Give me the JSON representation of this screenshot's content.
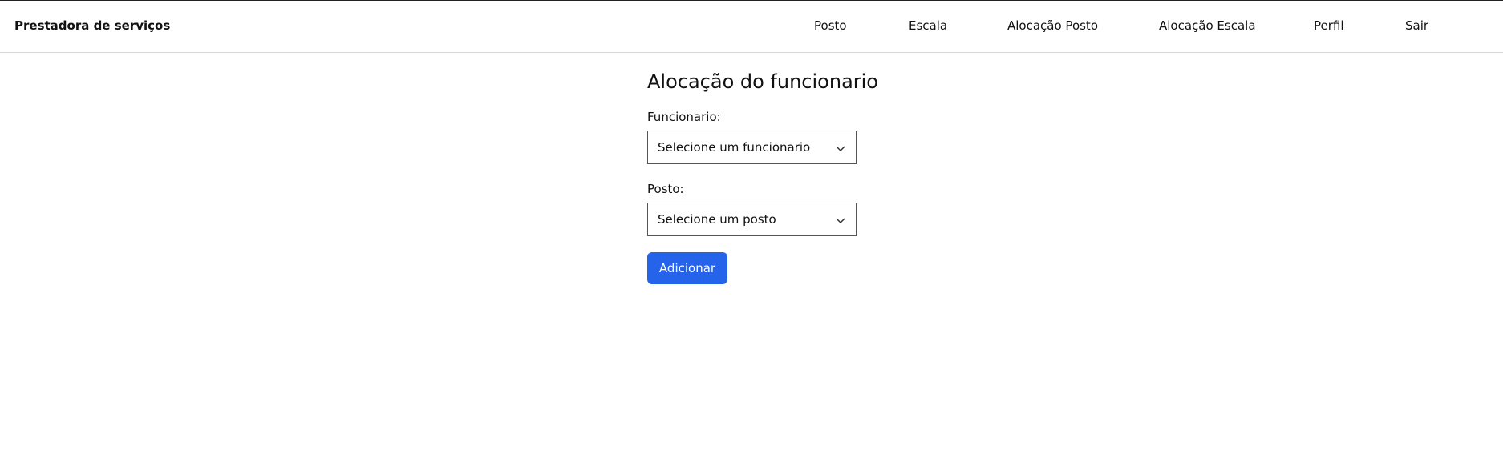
{
  "header": {
    "brand": "Prestadora de serviços",
    "nav": [
      {
        "label": "Posto"
      },
      {
        "label": "Escala"
      },
      {
        "label": "Alocação Posto"
      },
      {
        "label": "Alocação Escala"
      },
      {
        "label": "Perfil"
      },
      {
        "label": "Sair"
      }
    ]
  },
  "form": {
    "title": "Alocação do funcionario",
    "funcionario": {
      "label": "Funcionario:",
      "selected": "Selecione um funcionario"
    },
    "posto": {
      "label": "Posto:",
      "selected": "Selecione um posto"
    },
    "submit_label": "Adicionar"
  },
  "colors": {
    "accent": "#2563eb",
    "border": "#555555",
    "divider": "#d6d6d6"
  },
  "icons": {
    "select_arrow": "chevron-down-icon"
  }
}
